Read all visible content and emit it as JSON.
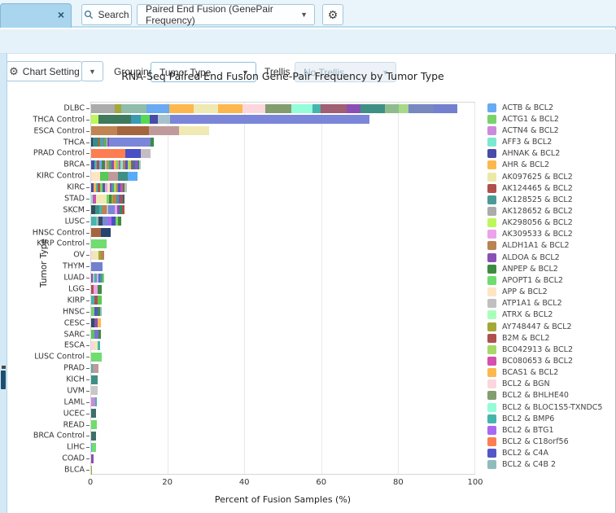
{
  "window": {
    "tab_close_label": "×"
  },
  "toolbar": {
    "search_label": "Search",
    "view_selector_value": "Paired End Fusion (GenePair Frequency)",
    "caret_glyph": "▼",
    "gear_glyph": "⚙"
  },
  "controls": {
    "chart_setting_label": "Chart Setting",
    "grouping_label": "Grouping",
    "grouping_value": "Tumor Type",
    "trellis_label": "Trellis",
    "trellis_value": "No Trellis"
  },
  "chart_data": {
    "type": "bar",
    "orientation": "horizontal",
    "stacked": true,
    "title": "RNA-Seq Paired End Fusion Gene-Pair Frequency by Tumor Type",
    "xlabel": "Percent of Fusion Samples (%)",
    "ylabel": "Tumor Type",
    "xlim": [
      0,
      100
    ],
    "xticks": [
      0,
      20,
      40,
      60,
      80,
      100
    ],
    "grid": "vertical",
    "legend_position": "right",
    "categories": [
      "DLBC",
      "THCA Control",
      "ESCA Control",
      "THCA",
      "PRAD Control",
      "BRCA",
      "KIRC Control",
      "KIRC",
      "STAD",
      "SKCM",
      "LUSC",
      "HNSC Control",
      "KIRP Control",
      "OV",
      "THYM",
      "LUAD",
      "LGG",
      "KIRP",
      "HNSC",
      "CESC",
      "SARC",
      "ESCA",
      "LUSC Control",
      "PRAD",
      "KICH",
      "UVM",
      "LAML",
      "UCEC",
      "READ",
      "BRCA Control",
      "LIHC",
      "COAD",
      "BLCA"
    ],
    "totals": [
      95.6,
      72.7,
      30.7,
      16.3,
      15.6,
      13.0,
      12.1,
      9.3,
      8.7,
      8.7,
      7.8,
      5.1,
      4.0,
      3.4,
      3.0,
      3.4,
      2.7,
      2.7,
      2.7,
      2.5,
      2.5,
      2.3,
      2.7,
      1.9,
      1.7,
      1.7,
      1.5,
      1.3,
      1.5,
      1.3,
      1.3,
      0.6,
      0.3
    ],
    "bars": [
      {
        "category": "DLBC",
        "segments": [
          [
            "#ababab",
            6.1
          ],
          [
            "#a3a838",
            1.7
          ],
          [
            "#8fbcab",
            6.6
          ],
          [
            "#6aaaf2",
            5.9
          ],
          [
            "#fcb84e",
            6.5
          ],
          [
            "#efe9b4",
            6.4
          ],
          [
            "#fcb84e",
            6.3
          ],
          [
            "#fbd7dd",
            6.0
          ],
          [
            "#839d6e",
            6.7
          ],
          [
            "#93fcd9",
            5.5
          ],
          [
            "#45b5ad",
            2.1
          ],
          [
            "#a05f72",
            6.8
          ],
          [
            "#8a4fb5",
            3.6
          ],
          [
            "#3f8f85",
            6.5
          ],
          [
            "#8fbc8f",
            3.6
          ],
          [
            "#a8d88a",
            2.6
          ],
          [
            "#7787c0",
            6.5
          ],
          [
            "#7380cf",
            6.2
          ]
        ]
      },
      {
        "category": "THCA Control",
        "segments": [
          [
            "#bdf75c",
            1.9
          ],
          [
            "#3f7a5c",
            8.5
          ],
          [
            "#3a9ab5",
            2.5
          ],
          [
            "#57d857",
            2.3
          ],
          [
            "#4a4aa8",
            2.3
          ],
          [
            "#a5c2ce",
            3.0
          ],
          [
            "#7b86d8",
            52.2
          ]
        ]
      },
      {
        "category": "ESCA Control",
        "segments": [
          [
            "#c08552",
            6.8
          ],
          [
            "#a5653f",
            8.2
          ],
          [
            "#c09a9a",
            8.0
          ],
          [
            "#efe9b4",
            7.7
          ]
        ]
      },
      {
        "category": "THCA",
        "segments": [
          [
            "#26456e",
            0.5
          ],
          [
            "#3a8a8a",
            1.5
          ],
          [
            "#b5651d",
            0.3
          ],
          [
            "#4aa8a0",
            0.8
          ],
          [
            "#9a66cc",
            0.4
          ],
          [
            "#57b857",
            0.5
          ],
          [
            "#c0c0c0",
            0.3
          ],
          [
            "#8a4fb5",
            0.4
          ],
          [
            "#7b86d8",
            10.8
          ],
          [
            "#3f8a42",
            0.6
          ],
          [
            "#2e8b57",
            0.2
          ]
        ]
      },
      {
        "category": "PRAD Control",
        "segments": [
          [
            "#fd7e50",
            8.9
          ],
          [
            "#4a4fc5",
            4.0
          ],
          [
            "#c4bec4",
            2.7
          ]
        ]
      },
      {
        "category": "BRCA",
        "segments": [
          [
            "#4a4aa8",
            0.8
          ],
          [
            "#45b5ad",
            0.7
          ],
          [
            "#b0504c",
            0.6
          ],
          [
            "#6aaaf2",
            0.7
          ],
          [
            "#3f8a42",
            0.8
          ],
          [
            "#eda2ec",
            0.5
          ],
          [
            "#a3a838",
            0.6
          ],
          [
            "#4a9a98",
            0.7
          ],
          [
            "#8a4fb5",
            0.6
          ],
          [
            "#fcb84e",
            0.5
          ],
          [
            "#77d36a",
            0.7
          ],
          [
            "#d44fae",
            0.5
          ],
          [
            "#7ce8d2",
            0.6
          ],
          [
            "#b98353",
            0.7
          ],
          [
            "#5356c5",
            0.6
          ],
          [
            "#a8d866",
            0.7
          ],
          [
            "#b0504c",
            0.5
          ],
          [
            "#3a7a9a",
            0.7
          ],
          [
            "#9a4fd5",
            0.5
          ],
          [
            "#2e8b57",
            0.5
          ],
          [
            "#c0c0c0",
            0.5
          ]
        ]
      },
      {
        "category": "KIRC Control",
        "segments": [
          [
            "#fde5c4",
            2.3
          ],
          [
            "#57c957",
            2.2
          ],
          [
            "#c09a9a",
            2.6
          ],
          [
            "#3f8f85",
            2.5
          ],
          [
            "#5aabf5",
            2.5
          ]
        ]
      },
      {
        "category": "KIRC",
        "segments": [
          [
            "#4a4aa8",
            0.7
          ],
          [
            "#fcb84e",
            0.5
          ],
          [
            "#45b5ad",
            0.6
          ],
          [
            "#b0504c",
            0.6
          ],
          [
            "#77d36a",
            0.6
          ],
          [
            "#3f6a8a",
            0.7
          ],
          [
            "#eda2ec",
            0.5
          ],
          [
            "#efe9b4",
            0.6
          ],
          [
            "#8a4fb5",
            0.6
          ],
          [
            "#4a9a98",
            0.6
          ],
          [
            "#a8d866",
            0.5
          ],
          [
            "#b98353",
            0.6
          ],
          [
            "#5356c5",
            0.6
          ],
          [
            "#d44fae",
            0.6
          ],
          [
            "#3f8a42",
            0.5
          ],
          [
            "#c0c0c0",
            0.5
          ]
        ]
      },
      {
        "category": "STAD",
        "segments": [
          [
            "#7ce8d2",
            0.5
          ],
          [
            "#d44fae",
            0.7
          ],
          [
            "#efe9b4",
            2.8
          ],
          [
            "#77d36a",
            0.6
          ],
          [
            "#3f8a42",
            0.7
          ],
          [
            "#a3a838",
            0.5
          ],
          [
            "#b98353",
            0.8
          ],
          [
            "#4a9a98",
            0.6
          ],
          [
            "#8a4fb5",
            0.5
          ],
          [
            "#b0504c",
            0.5
          ],
          [
            "#2e6e6e",
            0.5
          ]
        ]
      },
      {
        "category": "SKCM",
        "segments": [
          [
            "#2f4f5f",
            1.0
          ],
          [
            "#3f8f85",
            1.1
          ],
          [
            "#45b5ad",
            0.7
          ],
          [
            "#b98353",
            1.2
          ],
          [
            "#c0c0c0",
            0.5
          ],
          [
            "#7b86d8",
            1.6
          ],
          [
            "#eda2ec",
            0.6
          ],
          [
            "#8a4fb5",
            0.7
          ],
          [
            "#2e8b57",
            0.7
          ],
          [
            "#b0504c",
            0.6
          ]
        ]
      },
      {
        "category": "LUSC",
        "segments": [
          [
            "#45b5ad",
            1.2
          ],
          [
            "#8fbcbc",
            0.8
          ],
          [
            "#2f4f5f",
            0.9
          ],
          [
            "#7b86d8",
            1.5
          ],
          [
            "#a968f2",
            0.9
          ],
          [
            "#4a4fc5",
            1.0
          ],
          [
            "#77d36a",
            0.7
          ],
          [
            "#3f8a42",
            0.8
          ]
        ]
      },
      {
        "category": "HNSC Control",
        "segments": [
          [
            "#a5653f",
            2.5
          ],
          [
            "#26456e",
            2.6
          ]
        ]
      },
      {
        "category": "KIRP Control",
        "segments": [
          [
            "#6fdd6f",
            4.0
          ]
        ]
      },
      {
        "category": "OV",
        "segments": [
          [
            "#fbd7dd",
            0.4
          ],
          [
            "#efe9b4",
            1.6
          ],
          [
            "#a3a838",
            0.6
          ],
          [
            "#b98353",
            0.8
          ]
        ]
      },
      {
        "category": "THYM",
        "segments": [
          [
            "#7380cf",
            3.0
          ]
        ]
      },
      {
        "category": "LUAD",
        "segments": [
          [
            "#8a4fb5",
            0.5
          ],
          [
            "#c0c0c0",
            0.4
          ],
          [
            "#45b5ad",
            0.5
          ],
          [
            "#eda2ec",
            0.5
          ],
          [
            "#4a6fd4",
            0.5
          ],
          [
            "#4a9a98",
            0.5
          ],
          [
            "#77d36a",
            0.5
          ]
        ]
      },
      {
        "category": "LGG",
        "segments": [
          [
            "#b0504c",
            0.6
          ],
          [
            "#eda2ec",
            1.2
          ],
          [
            "#3f8a42",
            0.9
          ]
        ]
      },
      {
        "category": "KIRP",
        "segments": [
          [
            "#45b5ad",
            0.8
          ],
          [
            "#b0504c",
            0.9
          ],
          [
            "#57c957",
            1.0
          ]
        ]
      },
      {
        "category": "HNSC",
        "segments": [
          [
            "#77d36a",
            0.8
          ],
          [
            "#5356c5",
            0.9
          ],
          [
            "#3f8a42",
            0.6
          ],
          [
            "#8fbcbc",
            0.4
          ]
        ]
      },
      {
        "category": "CESC",
        "segments": [
          [
            "#2f4f5f",
            0.8
          ],
          [
            "#8a4fb5",
            0.9
          ],
          [
            "#fcb84e",
            0.8
          ]
        ]
      },
      {
        "category": "SARC",
        "segments": [
          [
            "#57c957",
            0.9
          ],
          [
            "#7a6fd4",
            1.0
          ],
          [
            "#3f8a42",
            0.6
          ]
        ]
      },
      {
        "category": "ESCA",
        "segments": [
          [
            "#fbd7dd",
            0.8
          ],
          [
            "#efe9b4",
            1.0
          ],
          [
            "#45b5ad",
            0.5
          ]
        ]
      },
      {
        "category": "LUSC Control",
        "segments": [
          [
            "#6fdd6f",
            2.7
          ]
        ]
      },
      {
        "category": "PRAD",
        "segments": [
          [
            "#45b5ad",
            0.4
          ],
          [
            "#c09a9a",
            1.5
          ]
        ]
      },
      {
        "category": "KICH",
        "segments": [
          [
            "#3f8f85",
            1.7
          ]
        ]
      },
      {
        "category": "UVM",
        "segments": [
          [
            "#c8c8c8",
            1.7
          ]
        ]
      },
      {
        "category": "LAML",
        "segments": [
          [
            "#cc8add",
            1.0
          ],
          [
            "#45b5ad",
            0.5
          ]
        ]
      },
      {
        "category": "UCEC",
        "segments": [
          [
            "#3f6f6a",
            1.3
          ]
        ]
      },
      {
        "category": "READ",
        "segments": [
          [
            "#6fdd6f",
            1.5
          ]
        ]
      },
      {
        "category": "BRCA Control",
        "segments": [
          [
            "#3f6f6a",
            1.3
          ]
        ]
      },
      {
        "category": "LIHC",
        "segments": [
          [
            "#5aabf5",
            0.3
          ],
          [
            "#6fdd6f",
            1.0
          ]
        ]
      },
      {
        "category": "COAD",
        "segments": [
          [
            "#8a4fb5",
            0.6
          ]
        ]
      },
      {
        "category": "BLCA",
        "segments": [
          [
            "#a3a838",
            0.3
          ]
        ]
      }
    ],
    "legend": [
      {
        "label": "ACTB & BCL2",
        "color": "#6aaaf2"
      },
      {
        "label": "ACTG1 & BCL2",
        "color": "#77d36a"
      },
      {
        "label": "ACTN4 & BCL2",
        "color": "#cc8add"
      },
      {
        "label": "AFF3 & BCL2",
        "color": "#7ce8d2"
      },
      {
        "label": "AHNAK & BCL2",
        "color": "#4a4aa8"
      },
      {
        "label": "AHR & BCL2",
        "color": "#fcb84e"
      },
      {
        "label": "AK097625 & BCL2",
        "color": "#ece9a8"
      },
      {
        "label": "AK124465 & BCL2",
        "color": "#b0504c"
      },
      {
        "label": "AK128525 & BCL2",
        "color": "#4a9a98"
      },
      {
        "label": "AK128652 & BCL2",
        "color": "#ababab"
      },
      {
        "label": "AK298056 & BCL2",
        "color": "#bdf75c"
      },
      {
        "label": "AK309533 & BCL2",
        "color": "#eda2ec"
      },
      {
        "label": "ALDH1A1 & BCL2",
        "color": "#b98353"
      },
      {
        "label": "ALDOA & BCL2",
        "color": "#8a4fb5"
      },
      {
        "label": "ANPEP & BCL2",
        "color": "#3f8a42"
      },
      {
        "label": "APOPT1 & BCL2",
        "color": "#6fdd6f"
      },
      {
        "label": "APP & BCL2",
        "color": "#fde5c4"
      },
      {
        "label": "ATP1A1 & BCL2",
        "color": "#c0c0c0"
      },
      {
        "label": "ATRX & BCL2",
        "color": "#aaffbb"
      },
      {
        "label": "AY748447 & BCL2",
        "color": "#a3a838"
      },
      {
        "label": "B2M & BCL2",
        "color": "#b0504c"
      },
      {
        "label": "BC042913 & BCL2",
        "color": "#a8d866"
      },
      {
        "label": "BC080653 & BCL2",
        "color": "#d44fae"
      },
      {
        "label": "BCAS1 & BCL2",
        "color": "#fcb84e"
      },
      {
        "label": "BCL2 & BGN",
        "color": "#fbd7dd"
      },
      {
        "label": "BCL2 & BHLHE40",
        "color": "#839d6e"
      },
      {
        "label": "BCL2 & BLOC1S5-TXNDC5",
        "color": "#93fcd9"
      },
      {
        "label": "BCL2 & BMP6",
        "color": "#45b5ad"
      },
      {
        "label": "BCL2 & BTG1",
        "color": "#a968f2"
      },
      {
        "label": "BCL2 & C18orf56",
        "color": "#fd7e50"
      },
      {
        "label": "BCL2 & C4A",
        "color": "#5356c5"
      },
      {
        "label": "BCL2 & C4B 2",
        "color": "#8fbcbc"
      }
    ]
  }
}
